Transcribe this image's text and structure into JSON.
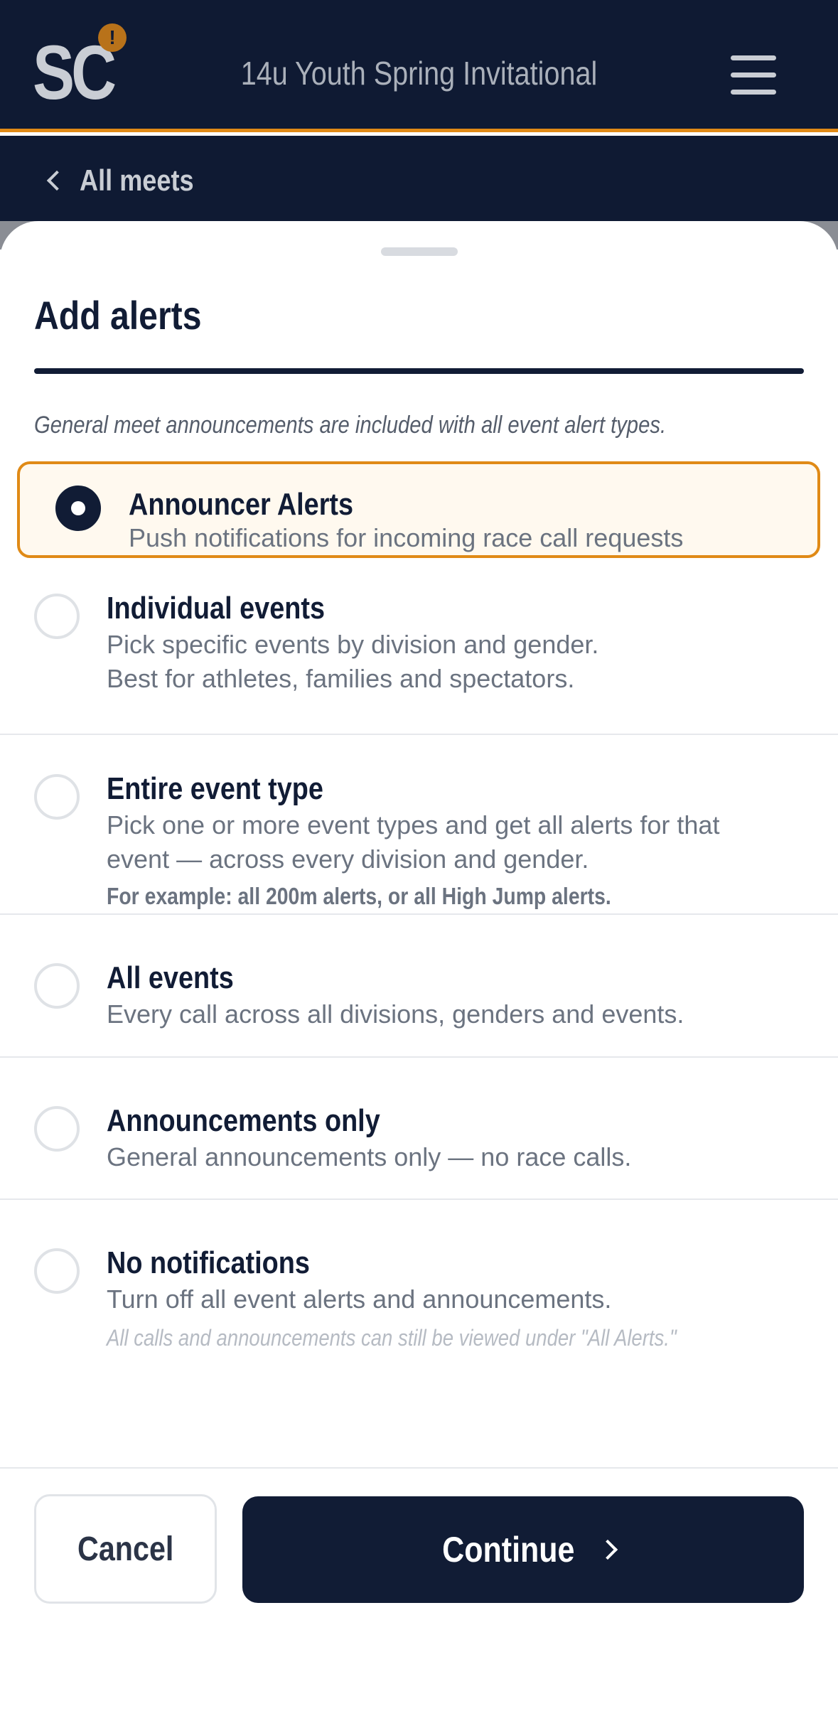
{
  "header": {
    "logo_text": "SC",
    "logo_badge": "!",
    "meet_title": "14u Youth Spring Invitational",
    "menu_icon": "hamburger-menu-icon"
  },
  "nav": {
    "back_label": "All meets",
    "back_icon": "chevron-left-icon"
  },
  "sheet": {
    "title": "Add alerts",
    "note": "General meet announcements are included with all event alert types.",
    "options": [
      {
        "title": "Announcer Alerts",
        "description": "Push notifications for incoming race call requests",
        "selected": true
      },
      {
        "title": "Individual events",
        "description_line1": "Pick specific events by division and gender.",
        "description_line2": "Best for athletes, families and spectators.",
        "selected": false
      },
      {
        "title": "Entire event type",
        "description_line1": "Pick one or more event types and get all alerts for that",
        "description_line2": "event — across every division and gender.",
        "example": "For example: all 200m alerts, or all High Jump alerts.",
        "selected": false
      },
      {
        "title": "All events",
        "description": "Every call across all divisions, genders and events.",
        "selected": false
      },
      {
        "title": "Announcements only",
        "description": "General announcements only — no race calls.",
        "selected": false
      },
      {
        "title": "No notifications",
        "description": "Turn off all event alerts and announcements.",
        "footnote": "All calls and announcements can still be viewed under \"All Alerts.\"",
        "selected": false
      }
    ]
  },
  "footer": {
    "cancel_label": "Cancel",
    "continue_label": "Continue",
    "continue_icon": "chevron-right-icon"
  },
  "colors": {
    "navy": "#111c35",
    "accent_orange": "#e08a16",
    "selected_bg": "#fff9ef"
  }
}
